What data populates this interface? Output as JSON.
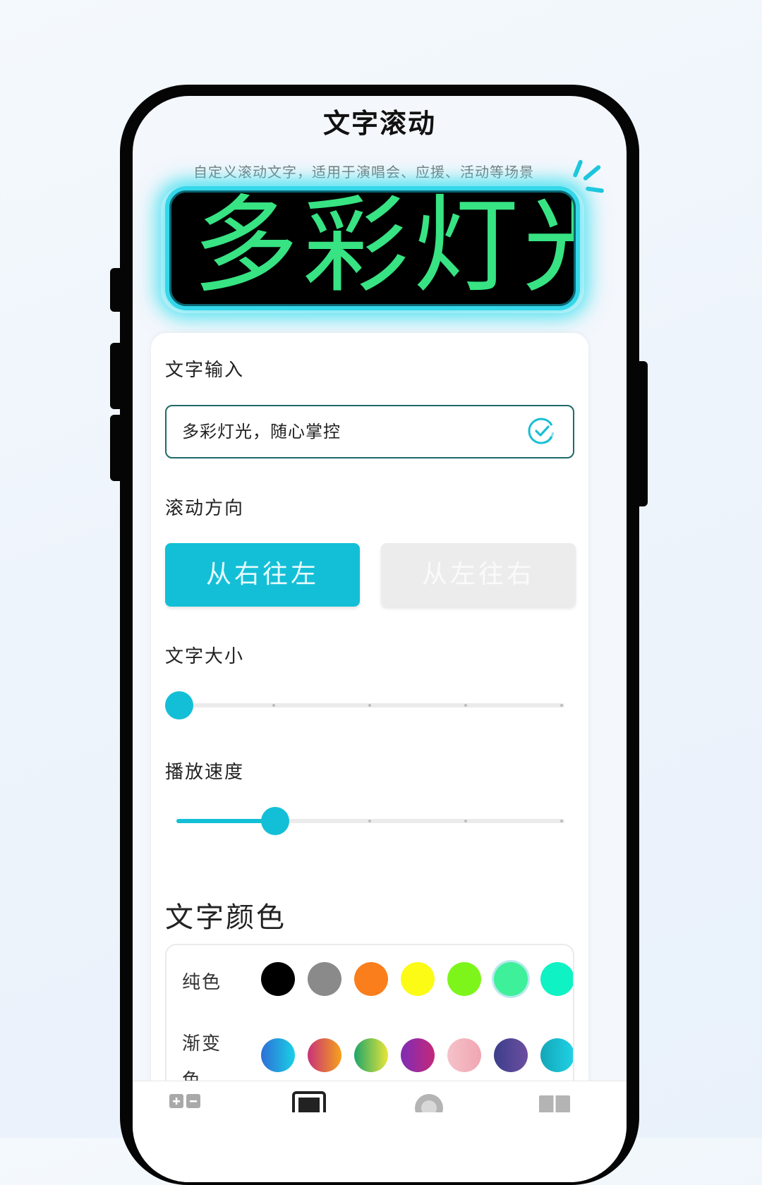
{
  "header": {
    "title": "文字滚动",
    "subtitle": "自定义滚动文字，适用于演唱会、应援、活动等场景"
  },
  "banner": {
    "preview_text": "多彩灯光",
    "text_color": "#37e383"
  },
  "settings": {
    "text_input": {
      "label": "文字输入",
      "value": "多彩灯光，随心掌控"
    },
    "direction": {
      "label": "滚动方向",
      "options": [
        "从右往左",
        "从左往右"
      ],
      "selected": "从右往左"
    },
    "text_size": {
      "label": "文字大小",
      "level": 0,
      "steps": 5
    },
    "speed": {
      "label": "播放速度",
      "level": 0.25,
      "steps": 5
    },
    "text_color": {
      "label": "文字颜色",
      "solid": {
        "label": "纯色",
        "colors": [
          "#000000",
          "#8a8a8a",
          "#fb7e1c",
          "#fbfb16",
          "#7ef51a",
          "#3ef09a",
          "#0ff2c4"
        ]
      },
      "gradient": {
        "label": "渐变色",
        "colors": [
          [
            "#2e6fd6",
            "#1ad0e6"
          ],
          [
            "#c8327a",
            "#f6a21b"
          ],
          [
            "#1fa56a",
            "#e9e53a"
          ],
          [
            "#7e2db6",
            "#c4287a"
          ],
          [
            "#f4c2c9",
            "#f1a6b3"
          ],
          [
            "#3c3f8c",
            "#6c4ea0"
          ],
          [
            "#13a6b8",
            "#20d2e6"
          ]
        ]
      }
    }
  },
  "accent_color": "#13bfd6"
}
